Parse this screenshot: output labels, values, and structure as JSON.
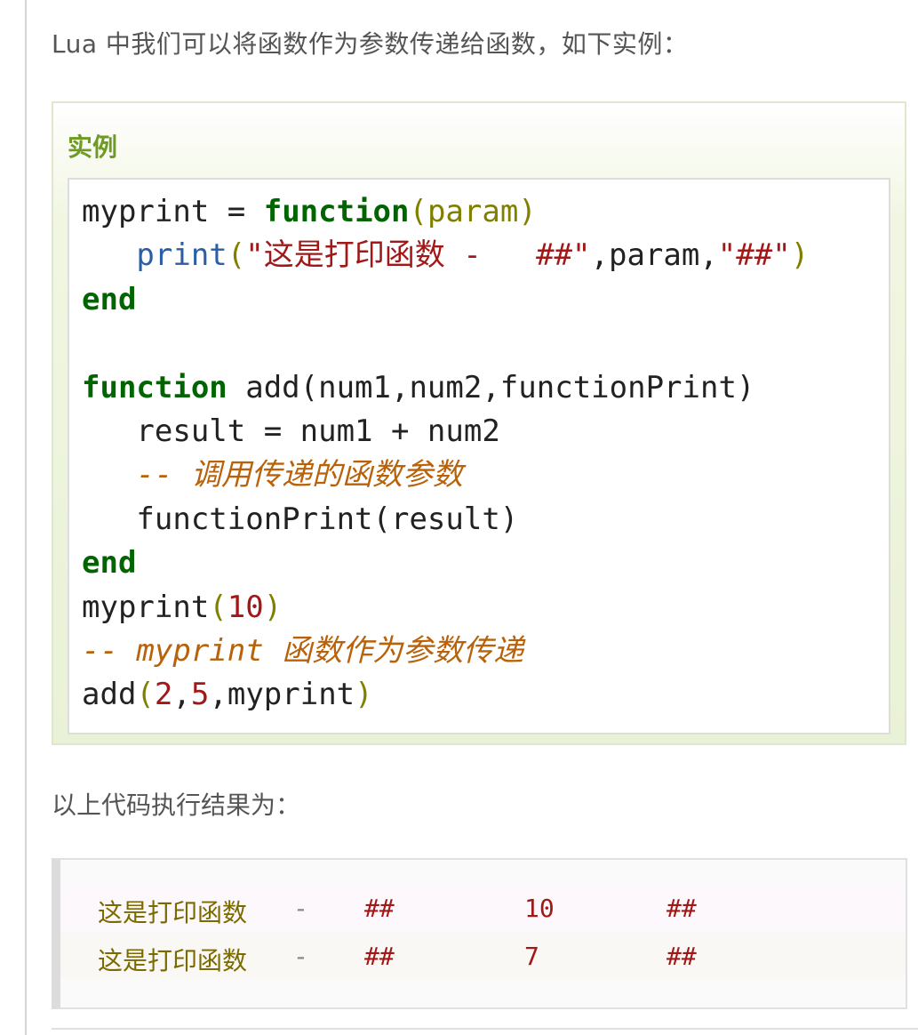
{
  "intro_text": "Lua 中我们可以将函数作为参数传递给函数，如下实例：",
  "example": {
    "title": "实例",
    "code": {
      "l1_name": "myprint",
      "l1_eq": " = ",
      "l1_kw": "function",
      "l1_params": "(param)",
      "l2_indent": "   ",
      "l2_fn": "print",
      "l2_str1": "\"这是打印函数 -   ##\"",
      "l2_mid": ",param,",
      "l2_str2": "\"##\"",
      "l3_kw": "end",
      "l5_kw": "function",
      "l5_sig": " add(num1,num2,functionPrint)",
      "l6": "   result = num1 + num2",
      "l7_cmt": "   -- 调用传递的函数参数",
      "l8": "   functionPrint(result)",
      "l9_kw": "end",
      "l10_name": "myprint",
      "l10_num": "10",
      "l11_cmt": "-- myprint 函数作为参数传递",
      "l12_name": "add",
      "l12_n1": "2",
      "l12_n2": "5",
      "l12_arg": "myprint"
    }
  },
  "result_label": "以上代码执行结果为：",
  "output": [
    {
      "text": "这是打印函数",
      "dash": "-",
      "h1": "##",
      "value": "10",
      "h2": "##"
    },
    {
      "text": "这是打印函数",
      "dash": "-",
      "h1": "##",
      "value": "7",
      "h2": "##"
    }
  ],
  "colors": {
    "keyword": "#006400",
    "string": "#a01818",
    "comment": "#b8620a",
    "builtin": "#2a5fa8",
    "example_title": "#6f9a23"
  }
}
